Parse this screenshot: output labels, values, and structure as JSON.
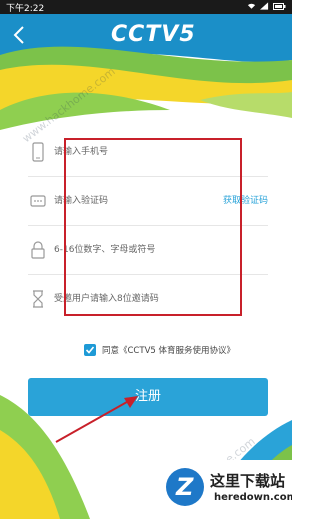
{
  "statusbar": {
    "time": "下午2:22"
  },
  "header": {
    "logo_text": "CCTV5"
  },
  "form": {
    "phone_placeholder": "请输入手机号",
    "code_placeholder": "请输入验证码",
    "get_code_label": "获取验证码",
    "password_placeholder": "6-16位数字、字母或符号",
    "invite_placeholder": "受邀用户请输入8位邀请码",
    "agree_text": "同意《CCTV5 体育服务使用协议》",
    "agree_checked": true,
    "register_label": "注册"
  },
  "watermarks": {
    "hackhome": "www.hackhome.com"
  },
  "footer": {
    "title": "这里下载站",
    "url": "heredown.com"
  },
  "colors": {
    "accent": "#2aa3d8",
    "highlight_box": "#c8202a",
    "header_bg": "#1b8fc8"
  }
}
